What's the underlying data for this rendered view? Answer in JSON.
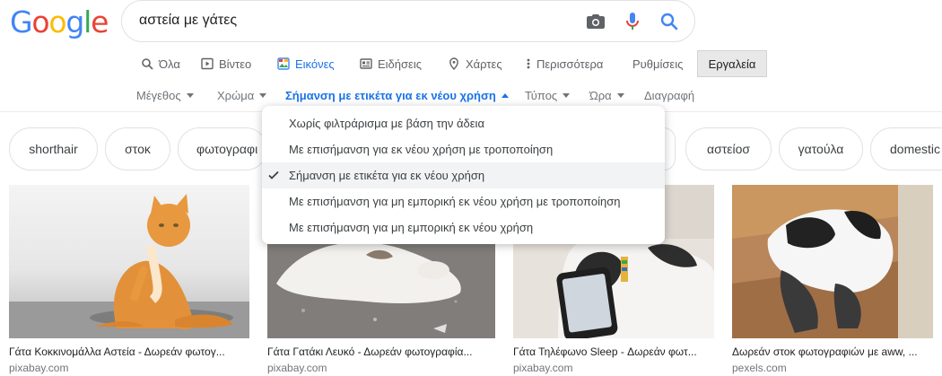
{
  "logo": {
    "l1": "G",
    "l2": "o",
    "l3": "o",
    "l4": "g",
    "l5": "l",
    "l6": "e"
  },
  "search": {
    "query": "αστεία με γάτες"
  },
  "tabs": [
    {
      "label": "Όλα",
      "icon": "search-icon"
    },
    {
      "label": "Βίντεο",
      "icon": "video-icon"
    },
    {
      "label": "Εικόνες",
      "icon": "image-icon"
    },
    {
      "label": "Ειδήσεις",
      "icon": "news-icon"
    },
    {
      "label": "Χάρτες",
      "icon": "map-pin-icon"
    },
    {
      "label": "Περισσότερα",
      "icon": "more-vert-icon"
    },
    {
      "label": "Ρυθμίσεις"
    }
  ],
  "tools_label": "Εργαλεία",
  "filters": [
    {
      "label": "Μέγεθος"
    },
    {
      "label": "Χρώμα"
    },
    {
      "label": "Σήμανση με ετικέτα για εκ νέου χρήση"
    },
    {
      "label": "Τύπος"
    },
    {
      "label": "Ώρα"
    },
    {
      "label": "Διαγραφή"
    }
  ],
  "chips": [
    "shorthair",
    "στοκ",
    "φωτογραφι",
    "αστείοσ",
    "γατούλα",
    "domestic"
  ],
  "license_menu": [
    {
      "label": "Χωρίς φιλτράρισμα με βάση την άδεια",
      "selected": false
    },
    {
      "label": "Με επισήμανση για εκ νέου χρήση με τροποποίηση",
      "selected": false
    },
    {
      "label": "Σήμανση με ετικέτα για εκ νέου χρήση",
      "selected": true
    },
    {
      "label": "Με επισήμανση για μη εμπορική εκ νέου χρήση με τροποποίηση",
      "selected": false
    },
    {
      "label": "Με επισήμανση για μη εμπορική εκ νέου χρήση",
      "selected": false
    }
  ],
  "results": [
    {
      "caption": "Γάτα Κοκκινομάλλα Αστεία - Δωρεάν φωτογ...",
      "source": "pixabay.com"
    },
    {
      "caption": "Γάτα Γατάκι Λευκό - Δωρεάν φωτογραφία...",
      "source": "pixabay.com"
    },
    {
      "caption": "Γάτα Τηλέφωνο Sleep - Δωρεάν φωτ...",
      "source": "pixabay.com"
    },
    {
      "caption": "Δωρεάν στοκ φωτογραφιών με aww, ...",
      "source": "pexels.com"
    }
  ],
  "colors": {
    "accent": "#1a73e8",
    "muted": "#70757a"
  }
}
